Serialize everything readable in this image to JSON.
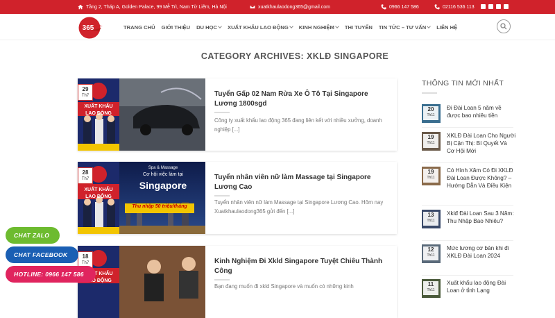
{
  "topbar": {
    "address": "Tầng 2, Tháp A, Golden Palace, 99 Mễ Trì, Nam Từ Liêm, Hà Nội",
    "email": "xuatkhaulaodong365@gmail.com",
    "phone1": "0966 147 586",
    "phone2": "02116 536 113",
    "bg_color": "#d0222b"
  },
  "logo": {
    "text": "365"
  },
  "nav": {
    "items": [
      {
        "label": "TRANG CHỦ",
        "dropdown": false
      },
      {
        "label": "GIỚI THIỆU",
        "dropdown": false
      },
      {
        "label": "DU HỌC",
        "dropdown": true
      },
      {
        "label": "XUẤT KHẨU LAO ĐỘNG",
        "dropdown": true
      },
      {
        "label": "KINH NGHIỆM",
        "dropdown": true
      },
      {
        "label": "THI TUYỂN",
        "dropdown": false
      },
      {
        "label": "TIN TỨC – TƯ VẤN",
        "dropdown": true
      },
      {
        "label": "LIÊN HỆ",
        "dropdown": false
      }
    ]
  },
  "page": {
    "title": "CATEGORY ARCHIVES: XKLĐ SINGAPORE"
  },
  "posts": [
    {
      "day": "29",
      "month": "Th7",
      "title": "Tuyển Gấp 02 Nam Rửa Xe Ô Tô Tại Singapore Lương 1800sgd",
      "excerpt": "Công ty xuất khẩu lao động 365 đang liên kết với nhiều xưởng, doanh nghiệp [...]",
      "thumb_label": "XUẤT KHẨU LAO ĐỘNG"
    },
    {
      "day": "28",
      "month": "Th7",
      "title": "Tuyển nhân viên nữ làm Massage tại Singapore Lương Cao",
      "excerpt": "Tuyển nhân viên nữ làm Massage tại Singapore Lương Cao. Hôm nay Xuatkhaulaodong365 gửi đến [...]",
      "thumb_label": "XUẤT KHẨU LAO ĐỘNG",
      "banner_small": "Spa & Massage",
      "banner_mid": "Cơ hội việc làm tại",
      "banner_big": "Singapore",
      "banner_pay": "Thu nhập 50 triệu/tháng"
    },
    {
      "day": "18",
      "month": "Th7",
      "title": "Kinh Nghiệm Đi Xkld Singapore Tuyệt Chiêu Thành Công",
      "excerpt": "Bạn đang muốn đi xkld Singapore và muốn có những kinh",
      "thumb_label": "XUẤT KHẨU LAO ĐỘNG"
    }
  ],
  "sidebar": {
    "title": "THÔNG TIN MỚI NHẤT",
    "items": [
      {
        "day": "20",
        "month": "Th11",
        "text": "Đi Đài Loan 5 năm về được bao nhiêu tiền"
      },
      {
        "day": "19",
        "month": "Th11",
        "text": "XKLĐ Đài Loan Cho Người Bị Cận Thị: Bí Quyết Và Cơ Hội Mới"
      },
      {
        "day": "19",
        "month": "Th11",
        "text": "Có Hình Xăm Có Đi XKLĐ Đài Loan Được Không? – Hướng Dẫn Và Điều Kiện"
      },
      {
        "day": "13",
        "month": "Th11",
        "text": "Xklđ Đài Loan Sau 3 Năm: Thu Nhập Bao Nhiêu?"
      },
      {
        "day": "12",
        "month": "Th11",
        "text": "Mức lương cơ bản khi đi XKLĐ Đài Loan 2024"
      },
      {
        "day": "11",
        "month": "Th11",
        "text": "Xuất khẩu lao động Đài Loan ở tỉnh Lạng"
      }
    ]
  },
  "floating": {
    "zalo": {
      "label": "CHAT ZALO",
      "color": "#6dbb2f"
    },
    "facebook": {
      "label": "CHAT FACEBOOK",
      "color": "#1a5fb4"
    },
    "hotline": {
      "label": "HOTLINE: 0966 147 586",
      "color": "#e0245e"
    }
  }
}
